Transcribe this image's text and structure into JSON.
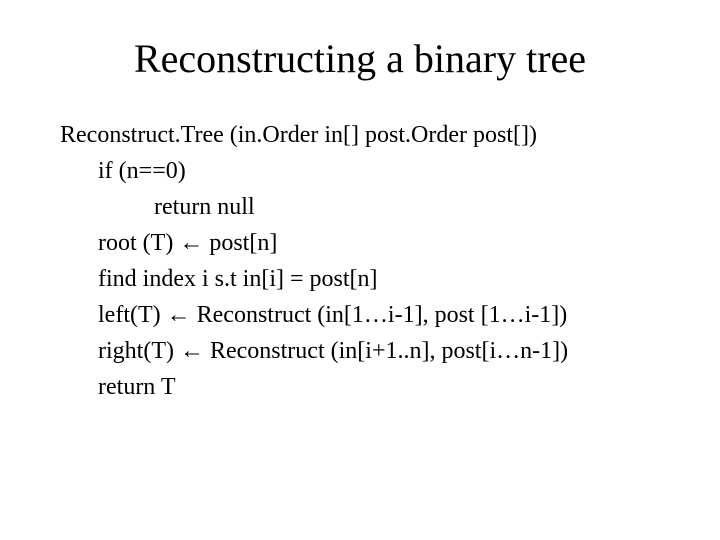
{
  "title": "Reconstructing a binary tree",
  "code": {
    "l1": "Reconstruct.Tree (in.Order in[] post.Order post[])",
    "l2": "if (n==0)",
    "l3": "return null",
    "l4a": "root (T) ",
    "l4arrow": "←",
    "l4b": " post[n]",
    "l5": "find index i s.t in[i] = post[n]",
    "l6a": "left(T) ",
    "l6arrow": "←",
    "l6b": " Reconstruct (in[1…i-1], post [1…i-1])",
    "l7a": "right(T) ",
    "l7arrow": "←",
    "l7b": " Reconstruct (in[i+1..n], post[i…n-1])",
    "l8": "return T"
  }
}
